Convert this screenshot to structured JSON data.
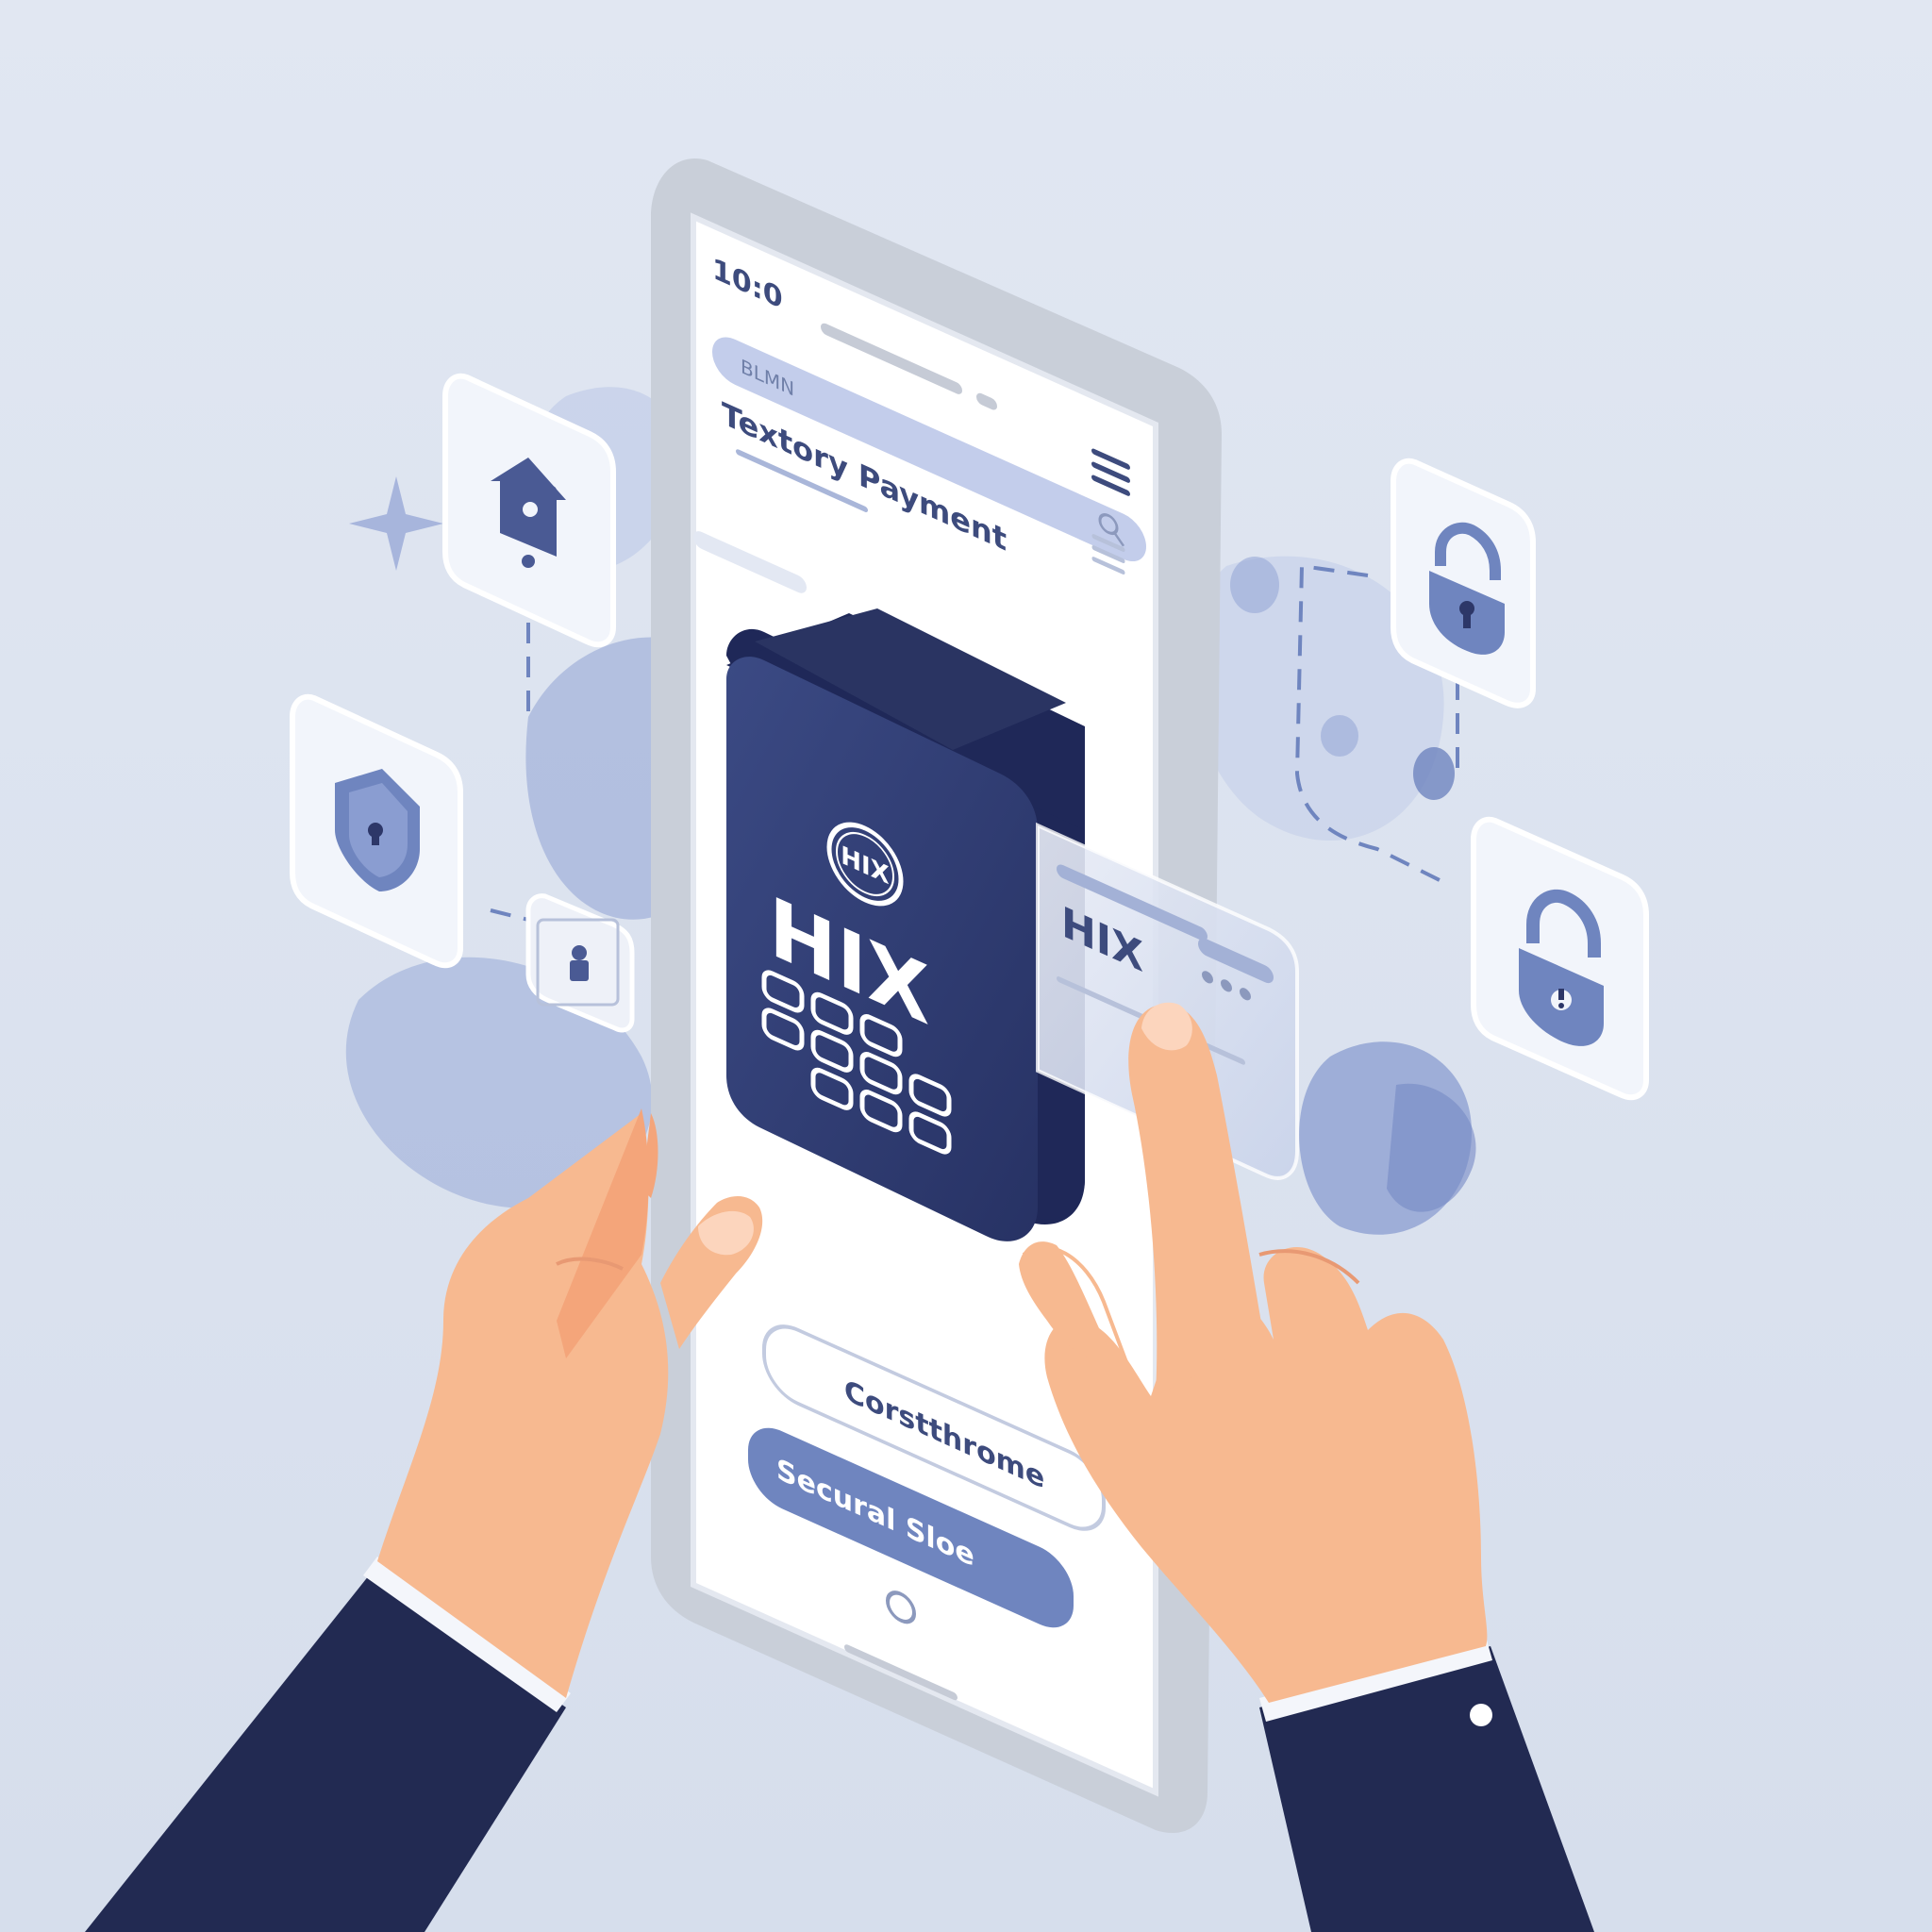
{
  "phone": {
    "status_time": "10:0",
    "search_text": "BLMN",
    "heading": "Textory Payment",
    "card_logo": "HIX",
    "card_title": "HIX",
    "mini_card_label": "HIX",
    "field_text": "Corstthrome",
    "button_label": "Secural Sloe"
  },
  "icons": [
    "house-lock-icon",
    "shield-lock-icon",
    "small-lock-icon",
    "padlock-icon",
    "padlock-alert-icon"
  ],
  "colors": {
    "background": "#dce3f0",
    "navy": "#2d3768",
    "accent": "#6f85bf",
    "skin": "#f7b990",
    "sleeve": "#222a52"
  }
}
